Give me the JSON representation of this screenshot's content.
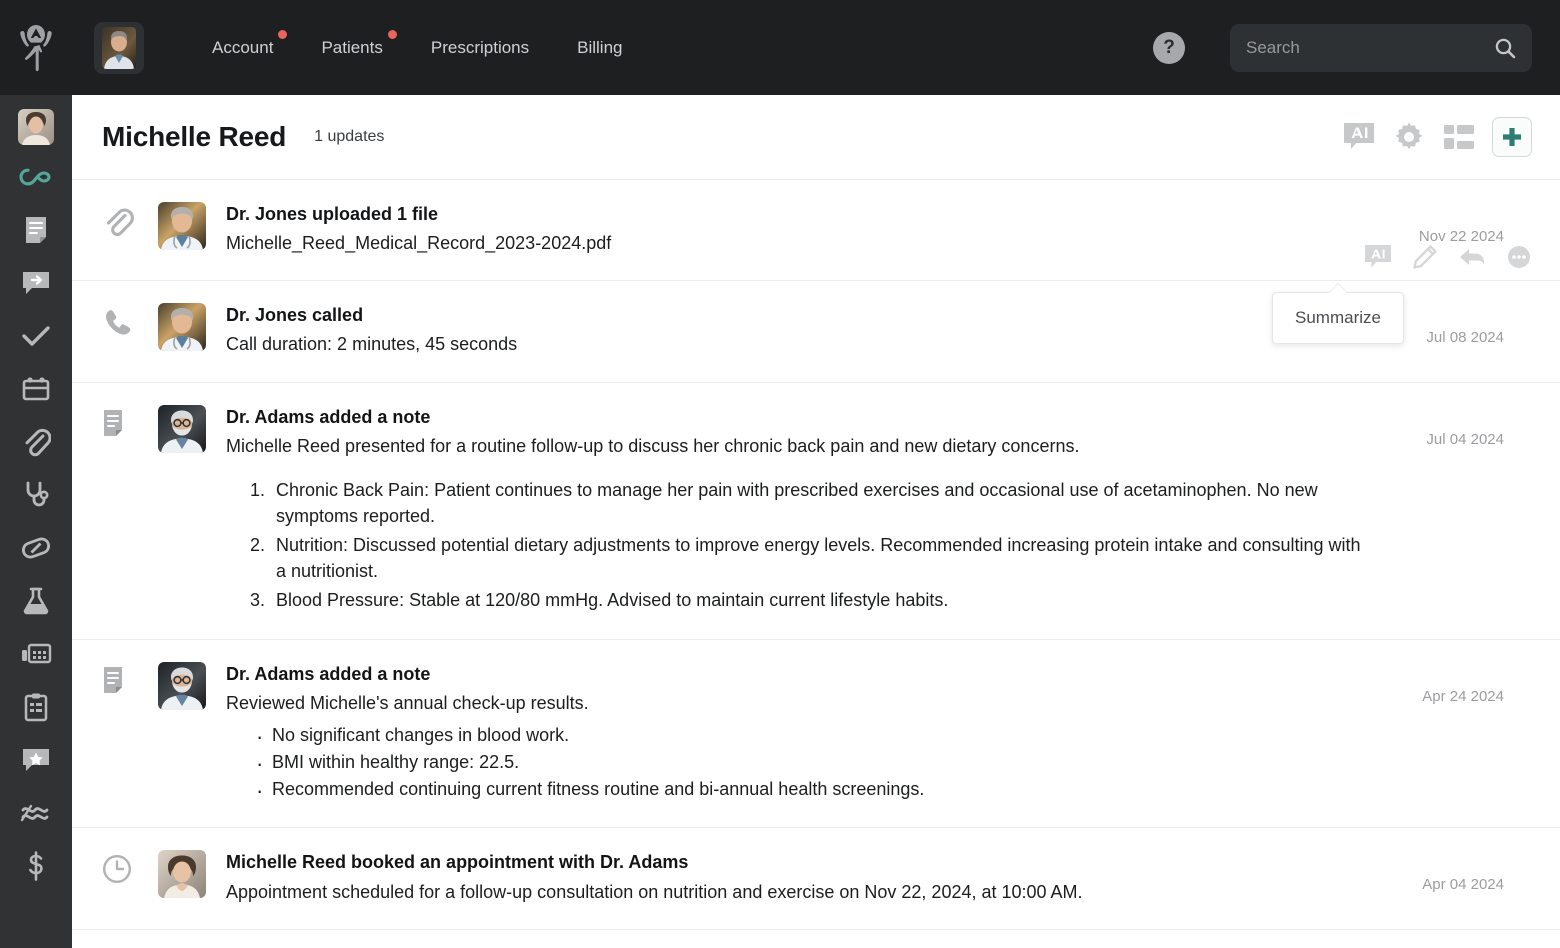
{
  "topbar": {
    "logo_name": "clinic-logo",
    "profile_avatar_alt": "Dr. Profile",
    "nav": [
      {
        "label": "Account",
        "badge": true
      },
      {
        "label": "Patients",
        "badge": true
      },
      {
        "label": "Prescriptions",
        "badge": false
      },
      {
        "label": "Billing",
        "badge": false
      }
    ],
    "help_glyph": "?",
    "search": {
      "value": "",
      "placeholder": "Search",
      "icon": "search-icon"
    }
  },
  "sidebar": {
    "avatar_alt": "Michelle Reed",
    "items": [
      {
        "icon": "infinity-icon",
        "label": "Timeline",
        "active": true
      },
      {
        "icon": "note-icon",
        "label": "Notes",
        "active": false
      },
      {
        "icon": "message-forward-icon",
        "label": "Messages",
        "active": false
      },
      {
        "icon": "check-icon",
        "label": "Tasks",
        "active": false
      },
      {
        "icon": "calendar-icon",
        "label": "Appointments",
        "active": false
      },
      {
        "icon": "paperclip-icon",
        "label": "Files",
        "active": false
      },
      {
        "icon": "stethoscope-icon",
        "label": "Exams",
        "active": false
      },
      {
        "icon": "pill-icon",
        "label": "Prescriptions",
        "active": false
      },
      {
        "icon": "flask-icon",
        "label": "Labs",
        "active": false
      },
      {
        "icon": "fax-icon",
        "label": "Fax",
        "active": false
      },
      {
        "icon": "clipboard-icon",
        "label": "Forms",
        "active": false
      },
      {
        "icon": "star-message-icon",
        "label": "Reviews",
        "active": false
      },
      {
        "icon": "vitals-icon",
        "label": "Vitals",
        "active": false
      },
      {
        "icon": "dollar-icon",
        "label": "Billing",
        "active": false
      }
    ]
  },
  "header": {
    "title": "Michelle Reed",
    "updates": "1 updates",
    "actions": [
      {
        "icon": "ai-summarize-icon",
        "label": "AI"
      },
      {
        "icon": "gear-icon",
        "label": "Settings"
      },
      {
        "icon": "layout-icon",
        "label": "Layout"
      },
      {
        "icon": "plus-icon",
        "label": "Add"
      }
    ]
  },
  "tooltip": {
    "text": "Summarize"
  },
  "row_actions": [
    {
      "icon": "ai-summarize-icon",
      "label": "Summarize"
    },
    {
      "icon": "pencil-icon",
      "label": "Edit"
    },
    {
      "icon": "reply-icon",
      "label": "Reply"
    },
    {
      "icon": "more-icon",
      "label": "More"
    }
  ],
  "feed": [
    {
      "type_icon": "paperclip-icon",
      "avatar": "dr-jones",
      "title": "Dr. Jones uploaded 1 file",
      "desc": "Michelle_Reed_Medical_Record_2023-2024.pdf",
      "date": "Nov 22 2024"
    },
    {
      "type_icon": "phone-icon",
      "avatar": "dr-jones",
      "title": "Dr. Jones called",
      "desc": "Call duration: 2 minutes, 45 seconds",
      "date": "Jul 08 2024"
    },
    {
      "type_icon": "note-icon",
      "avatar": "dr-adams",
      "title": "Dr. Adams added a note",
      "desc": "Michelle Reed presented for a routine follow-up to discuss her chronic back pain and new dietary concerns.",
      "date": "Jul 04 2024",
      "ordered_list": [
        "Chronic Back Pain: Patient continues to manage her pain with prescribed exercises and occasional use of acetaminophen. No new symptoms reported.",
        "Nutrition: Discussed potential dietary adjustments to improve energy levels. Recommended increasing protein intake and consulting with a nutritionist.",
        "Blood Pressure: Stable at 120/80 mmHg. Advised to maintain current lifestyle habits."
      ]
    },
    {
      "type_icon": "note-icon",
      "avatar": "dr-adams",
      "title": "Dr. Adams added a note",
      "desc": "Reviewed Michelle's annual check-up results.",
      "date": "Apr 24 2024",
      "bullet_list": [
        "No significant changes in blood work.",
        "BMI within healthy range: 22.5.",
        "Recommended continuing current fitness routine and bi-annual health screenings."
      ]
    },
    {
      "type_icon": "clock-icon",
      "avatar": "michelle-reed",
      "title": "Michelle Reed booked an appointment with Dr. Adams",
      "desc": "Appointment scheduled for a follow-up consultation on nutrition and exercise on Nov 22, 2024, at 10:00 AM.",
      "date": "Apr 04 2024"
    }
  ],
  "colors": {
    "topbar_bg": "#1d1f21",
    "sidebar_bg": "#303234",
    "accent_teal": "#2d7d74",
    "badge_red": "#e8655e",
    "icon_grey": "#b6b8ba"
  }
}
